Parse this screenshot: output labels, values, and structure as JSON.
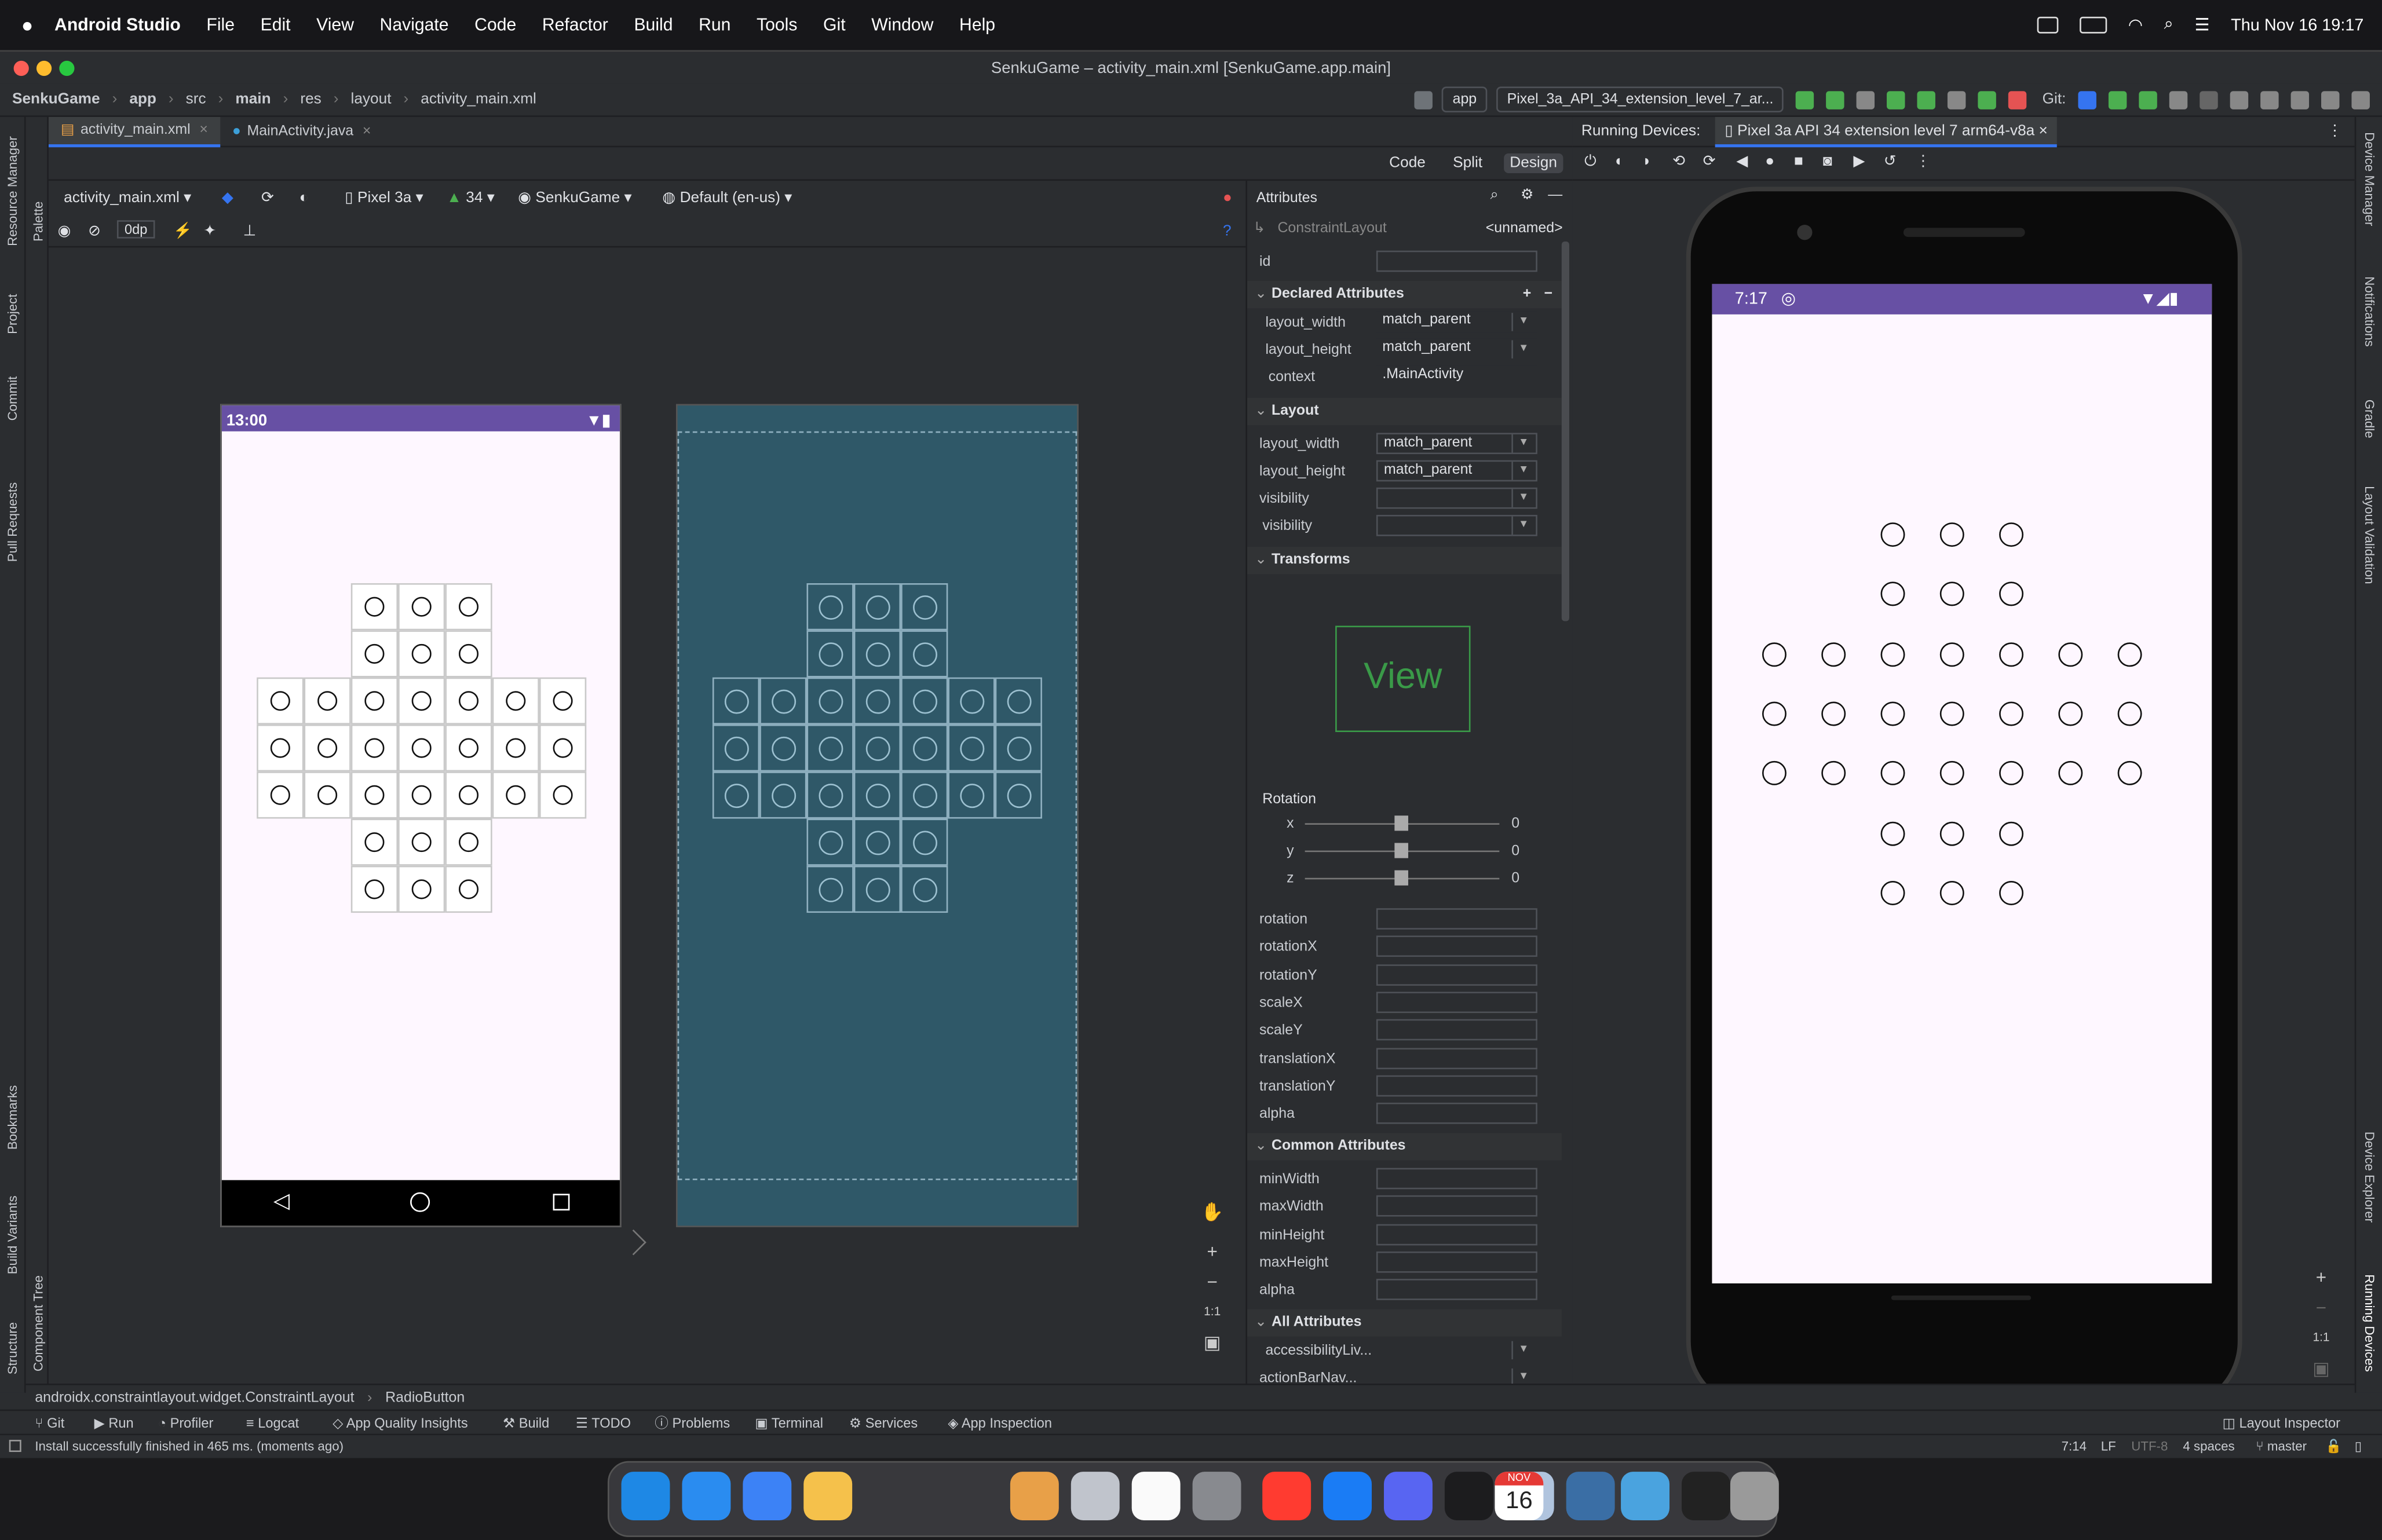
{
  "menubar": {
    "apple": "",
    "app": "Android Studio",
    "items": [
      "File",
      "Edit",
      "View",
      "Navigate",
      "Code",
      "Refactor",
      "Build",
      "Run",
      "Tools",
      "Git",
      "Window",
      "Help"
    ],
    "datetime": "Thu Nov 16  19:17"
  },
  "window": {
    "title": "SenkuGame – activity_main.xml [SenkuGame.app.main]"
  },
  "nav": {
    "breadcrumbs": [
      "SenkuGame",
      "app",
      "src",
      "main",
      "res",
      "layout",
      "activity_main.xml"
    ],
    "run_config": "app",
    "device_selector": "Pixel_3a_API_34_extension_level_7_ar...",
    "git_label": "Git:"
  },
  "editor": {
    "tabs": [
      {
        "label": "activity_main.xml"
      },
      {
        "label": "MainActivity.java"
      }
    ],
    "modes": [
      "Code",
      "Split",
      "Design"
    ],
    "active_mode": "Design"
  },
  "design_toolbar": {
    "file": "activity_main.xml",
    "device": "Pixel 3a",
    "api": "34",
    "theme": "SenkuGame",
    "locale": "Default (en-us)",
    "margin": "0dp"
  },
  "preview": {
    "status_time": "13:00",
    "grid_rows": [
      [
        0,
        0,
        1,
        1,
        1,
        0,
        0
      ],
      [
        0,
        0,
        1,
        1,
        1,
        0,
        0
      ],
      [
        1,
        1,
        1,
        1,
        1,
        1,
        1
      ],
      [
        1,
        1,
        1,
        1,
        1,
        1,
        1
      ],
      [
        1,
        1,
        1,
        1,
        1,
        1,
        1
      ],
      [
        0,
        0,
        1,
        1,
        1,
        0,
        0
      ],
      [
        0,
        0,
        1,
        1,
        1,
        0,
        0
      ]
    ]
  },
  "attributes": {
    "title": "Attributes",
    "component": "ConstraintLayout",
    "component_name": "<unnamed>",
    "id_label": "id",
    "declared": {
      "header": "Declared Attributes",
      "rows": [
        {
          "name": "layout_width",
          "value": "match_parent"
        },
        {
          "name": "layout_height",
          "value": "match_parent"
        },
        {
          "name": "context",
          "value": ".MainActivity"
        }
      ]
    },
    "layout": {
      "header": "Layout",
      "rows": [
        {
          "name": "layout_width",
          "value": "match_parent"
        },
        {
          "name": "layout_height",
          "value": "match_parent"
        },
        {
          "name": "visibility",
          "value": ""
        },
        {
          "name": "visibility",
          "value": ""
        }
      ]
    },
    "transforms": {
      "header": "Transforms",
      "view_label": "View",
      "rotation_label": "Rotation",
      "axes": [
        {
          "axis": "x",
          "value": "0"
        },
        {
          "axis": "y",
          "value": "0"
        },
        {
          "axis": "z",
          "value": "0"
        }
      ],
      "rows": [
        "rotation",
        "rotationX",
        "rotationY",
        "scaleX",
        "scaleY",
        "translationX",
        "translationY",
        "alpha"
      ]
    },
    "common": {
      "header": "Common Attributes",
      "rows": [
        "minWidth",
        "maxWidth",
        "minHeight",
        "maxHeight",
        "alpha"
      ]
    },
    "all": {
      "header": "All Attributes",
      "rows": [
        "accessibilityLiv...",
        "actionBarNav..."
      ]
    }
  },
  "running": {
    "label": "Running Devices:",
    "device_tab": "Pixel 3a API 34 extension level 7 arm64-v8a",
    "status_time": "7:17"
  },
  "side_left": [
    "Resource Manager",
    "Project",
    "Commit",
    "Pull Requests",
    "Bookmarks",
    "Build Variants",
    "Structure"
  ],
  "side_left2": [
    "Palette",
    "Component Tree"
  ],
  "side_right": [
    "Device Manager",
    "Notifications",
    "Gradle",
    "Layout Validation",
    "Device Explorer",
    "Running Devices"
  ],
  "crumbbar": {
    "items": [
      "androidx.constraintlayout.widget.ConstraintLayout",
      "RadioButton"
    ]
  },
  "toolwindows": [
    "Git",
    "Run",
    "Profiler",
    "Logcat",
    "App Quality Insights",
    "Build",
    "TODO",
    "Problems",
    "Terminal",
    "Services",
    "App Inspection"
  ],
  "layout_inspector": "Layout Inspector",
  "status": {
    "message": "Install successfully finished in 465 ms. (moments ago)",
    "position": "7:14",
    "line_sep": "LF",
    "encoding": "UTF-8",
    "indent": "4 spaces",
    "branch": "master"
  },
  "zoom": {
    "plus": "+",
    "minus": "−",
    "one": "1:1"
  },
  "dock": {
    "calendar_month": "NOV",
    "calendar_day": "16",
    "colors": [
      "#1e88e5",
      "#2a8cf0",
      "#3c82f6",
      "#f5c14b",
      "#f2f2f2",
      "#e8a048",
      "#c0c4cc",
      "#fafafa",
      "#888a8f",
      "#ff3b30",
      "#1a7cf5",
      "#5865f2",
      "#1c1c1e",
      "#b0c4de",
      "#3a6ea5",
      "#4aa3df",
      "#222",
      "#9a9a9a"
    ]
  }
}
